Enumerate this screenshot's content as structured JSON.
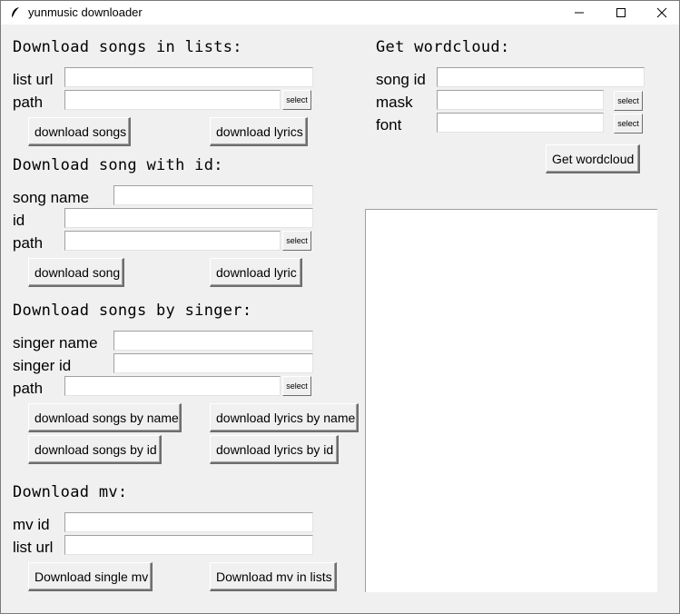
{
  "window": {
    "title": "yunmusic downloader",
    "icon": "feather-icon",
    "controls": [
      "minimize-icon",
      "maximize-icon",
      "close-icon"
    ]
  },
  "lists": {
    "title": "Download songs in lists:",
    "list_url_label": "list url",
    "list_url_value": "",
    "path_label": "path",
    "path_value": "",
    "select_label": "select",
    "download_songs": "download songs",
    "download_lyrics": "download lyrics"
  },
  "song_id": {
    "title": "Download song with id:",
    "song_name_label": "song name",
    "song_name_value": "",
    "id_label": "id",
    "id_value": "",
    "path_label": "path",
    "path_value": "",
    "select_label": "select",
    "download_song": "download song",
    "download_lyric": "download lyric"
  },
  "singer": {
    "title": "Download songs by singer:",
    "singer_name_label": "singer name",
    "singer_name_value": "",
    "singer_id_label": "singer id",
    "singer_id_value": "",
    "path_label": "path",
    "path_value": "",
    "select_label": "select",
    "songs_by_name": "download songs by name",
    "lyrics_by_name": "download lyrics by name",
    "songs_by_id": "download songs by id",
    "lyrics_by_id": "download lyrics by id"
  },
  "mv": {
    "title": "Download mv:",
    "mv_id_label": "mv id",
    "mv_id_value": "",
    "list_url_label": "list url",
    "list_url_value": "",
    "single_mv": "Download single mv",
    "mv_in_lists": "Download mv in lists"
  },
  "wordcloud": {
    "title": "Get wordcloud:",
    "song_id_label": "song id",
    "song_id_value": "",
    "mask_label": "mask",
    "mask_value": "",
    "font_label": "font",
    "font_value": "",
    "select_label": "select",
    "get_button": "Get wordcloud"
  }
}
